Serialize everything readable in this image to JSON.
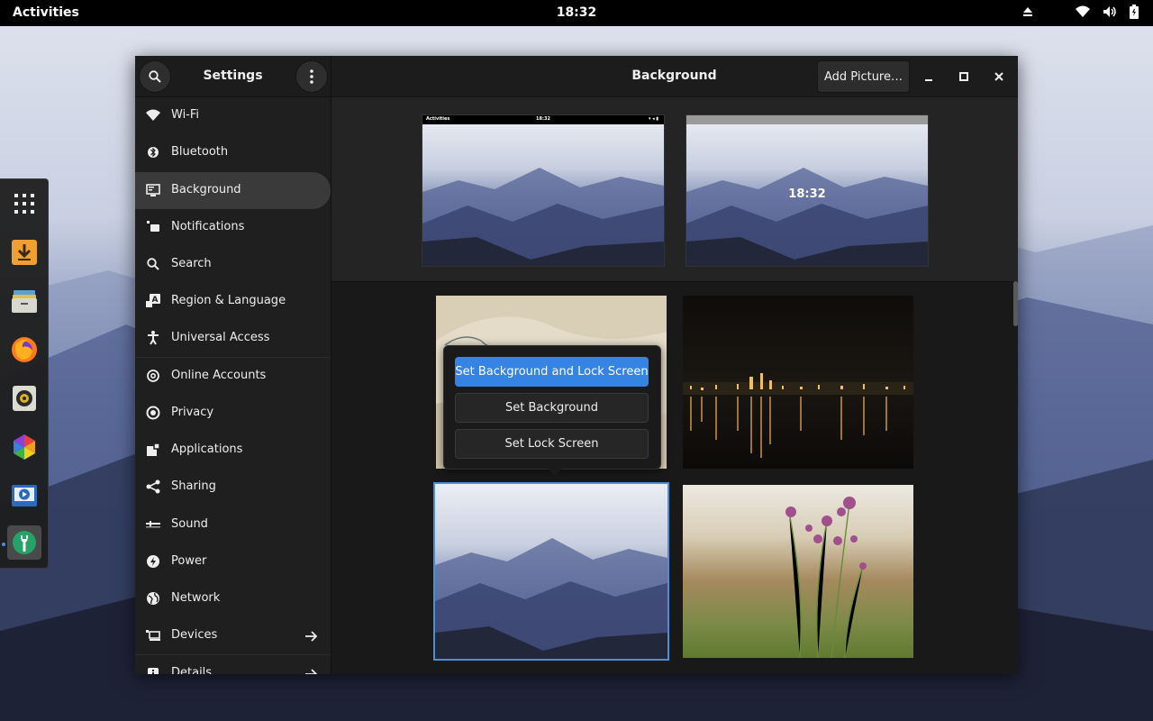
{
  "topbar": {
    "activities": "Activities",
    "clock": "18:32",
    "icons": [
      "eject-icon",
      "wifi-icon",
      "volume-icon",
      "battery-icon"
    ]
  },
  "dock": {
    "items": [
      {
        "name": "app-grid-icon"
      },
      {
        "name": "downloader-icon"
      },
      {
        "name": "file-manager-icon"
      },
      {
        "name": "firefox-icon"
      },
      {
        "name": "music-player-icon"
      },
      {
        "name": "color-picker-icon"
      },
      {
        "name": "video-player-icon"
      },
      {
        "name": "settings-icon",
        "active": true
      }
    ]
  },
  "window": {
    "sidebar_title": "Settings",
    "page_title": "Background",
    "add_picture": "Add Picture…"
  },
  "sidebar": {
    "items": [
      {
        "label": "Wi-Fi",
        "icon": "wifi-icon"
      },
      {
        "label": "Bluetooth",
        "icon": "bluetooth-icon"
      },
      {
        "label": "Background",
        "icon": "background-icon",
        "selected": true
      },
      {
        "label": "Notifications",
        "icon": "notifications-icon"
      },
      {
        "label": "Search",
        "icon": "search-icon"
      },
      {
        "label": "Region & Language",
        "icon": "region-language-icon"
      },
      {
        "label": "Universal Access",
        "icon": "universal-access-icon"
      },
      {
        "label": "Online Accounts",
        "icon": "online-accounts-icon"
      },
      {
        "label": "Privacy",
        "icon": "privacy-icon"
      },
      {
        "label": "Applications",
        "icon": "applications-icon"
      },
      {
        "label": "Sharing",
        "icon": "sharing-icon"
      },
      {
        "label": "Sound",
        "icon": "sound-icon"
      },
      {
        "label": "Power",
        "icon": "power-icon"
      },
      {
        "label": "Network",
        "icon": "network-icon"
      },
      {
        "label": "Devices",
        "icon": "devices-icon",
        "arrow": true
      },
      {
        "label": "Details",
        "icon": "details-icon",
        "arrow": true
      }
    ]
  },
  "preview": {
    "desktop_activities": "Activities",
    "desktop_clock": "18:32",
    "lock_clock": "18:32"
  },
  "popover": {
    "primary": "Set Background and Lock Screen",
    "set_background": "Set Background",
    "set_lock_screen": "Set Lock Screen"
  },
  "colors": {
    "accent": "#3584e4",
    "selection_border": "#4a90d9",
    "sidebar_bg": "#1f1f1f",
    "header_bg": "#1c1c1c"
  }
}
